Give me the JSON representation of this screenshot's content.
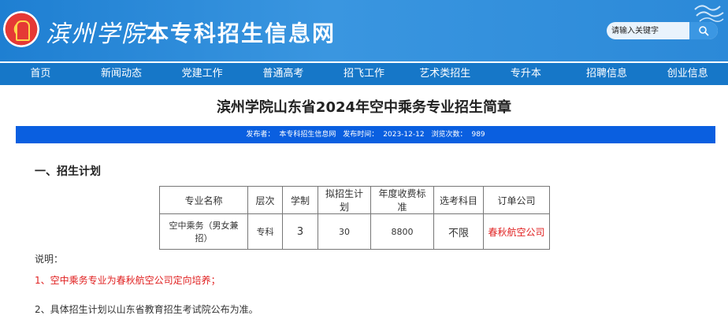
{
  "header": {
    "logo_text": "滨州学院",
    "site_title": "本专科招生信息网",
    "search_placeholder": "请输入关键字"
  },
  "nav": [
    "首页",
    "新闻动态",
    "党建工作",
    "普通高考",
    "招飞工作",
    "艺术类招生",
    "专升本",
    "招聘信息",
    "创业信息"
  ],
  "article": {
    "title": "滨州学院山东省2024年空中乘务专业招生简章",
    "meta": {
      "publisher_label": "发布者：",
      "publisher": "本专科招生信息网",
      "time_label": "发布时间：",
      "time": "2023-12-12",
      "views_label": "浏览次数：",
      "views": "989"
    },
    "section_heading": "一、招生计划",
    "table": {
      "headers": [
        "专业名称",
        "层次",
        "学制",
        "拟招生计划",
        "年度收费标准",
        "选考科目",
        "订单公司"
      ],
      "row": [
        "空中乘务（男女兼招）",
        "专科",
        "3",
        "30",
        "8800",
        "不限",
        "春秋航空公司"
      ]
    },
    "note_label": "说明：",
    "notes": [
      "1、空中乘务专业为春秋航空公司定向培养；",
      "2、具体招生计划以山东省教育招生考试院公布为准。"
    ]
  },
  "colors": {
    "header_blue": "#2b89d8",
    "nav_blue": "#1677c8",
    "meta_bar_blue": "#0a5fe0",
    "highlight_red": "#e02020"
  }
}
